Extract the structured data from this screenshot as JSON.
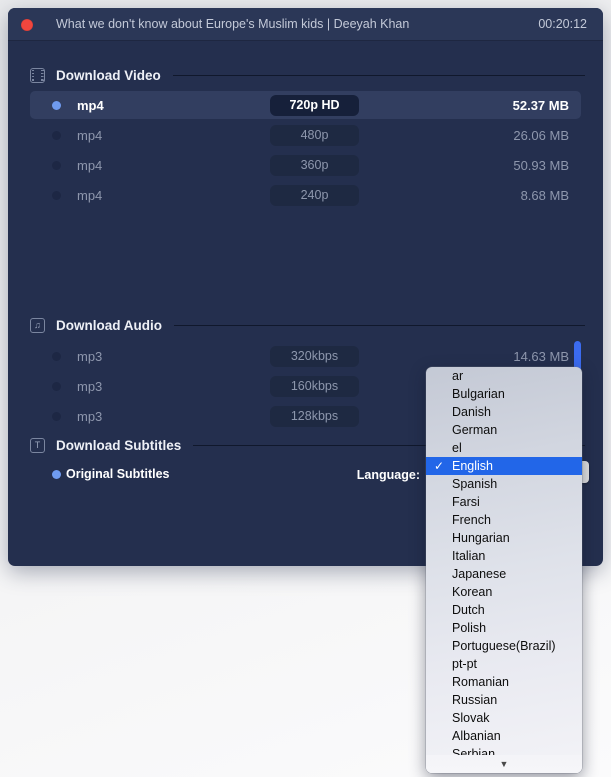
{
  "window": {
    "title": "What we don't know about Europe's Muslim kids | Deeyah Khan",
    "duration": "00:20:12",
    "close_label": "close"
  },
  "video_section": {
    "icon": "film-strip-icon",
    "title": "Download Video",
    "rows": [
      {
        "format": "mp4",
        "quality": "720p HD",
        "size": "52.37 MB",
        "selected": true
      },
      {
        "format": "mp4",
        "quality": "480p",
        "size": "26.06 MB",
        "selected": false
      },
      {
        "format": "mp4",
        "quality": "360p",
        "size": "50.93 MB",
        "selected": false
      },
      {
        "format": "mp4",
        "quality": "240p",
        "size": "8.68 MB",
        "selected": false
      }
    ]
  },
  "audio_section": {
    "icon": "music-note-icon",
    "title": "Download Audio",
    "icon_glyph": "♫",
    "rows": [
      {
        "format": "mp3",
        "quality": "320kbps",
        "size": "14.63 MB",
        "selected": false
      },
      {
        "format": "mp3",
        "quality": "160kbps",
        "size": "",
        "selected": false
      },
      {
        "format": "mp3",
        "quality": "128kbps",
        "size": "",
        "selected": false
      }
    ]
  },
  "subtitles_section": {
    "icon": "text-subtitle-icon",
    "icon_glyph": "T",
    "title": "Download Subtitles",
    "option_label": "Original Subtitles",
    "language_label": "Language:",
    "selected_language": "English"
  },
  "language_dropdown": {
    "selected": "English",
    "items": [
      "ar",
      "Bulgarian",
      "Danish",
      "German",
      "el",
      "English",
      "Spanish",
      "Farsi",
      "French",
      "Hungarian",
      "Italian",
      "Japanese",
      "Korean",
      "Dutch",
      "Polish",
      "Portuguese(Brazil)",
      "pt-pt",
      "Romanian",
      "Russian",
      "Slovak",
      "Albanian",
      "Serbian"
    ],
    "scroll_down_glyph": "▼"
  },
  "colors": {
    "window_bg": "#242f4e",
    "titlebar_bg": "#2b3757",
    "accent_blue": "#6f9bf0",
    "close_red": "#f0463e",
    "scrollbar_blue": "#3b6bf0",
    "download_button": "#8e96e0",
    "highlight_blue": "#2266e8"
  }
}
